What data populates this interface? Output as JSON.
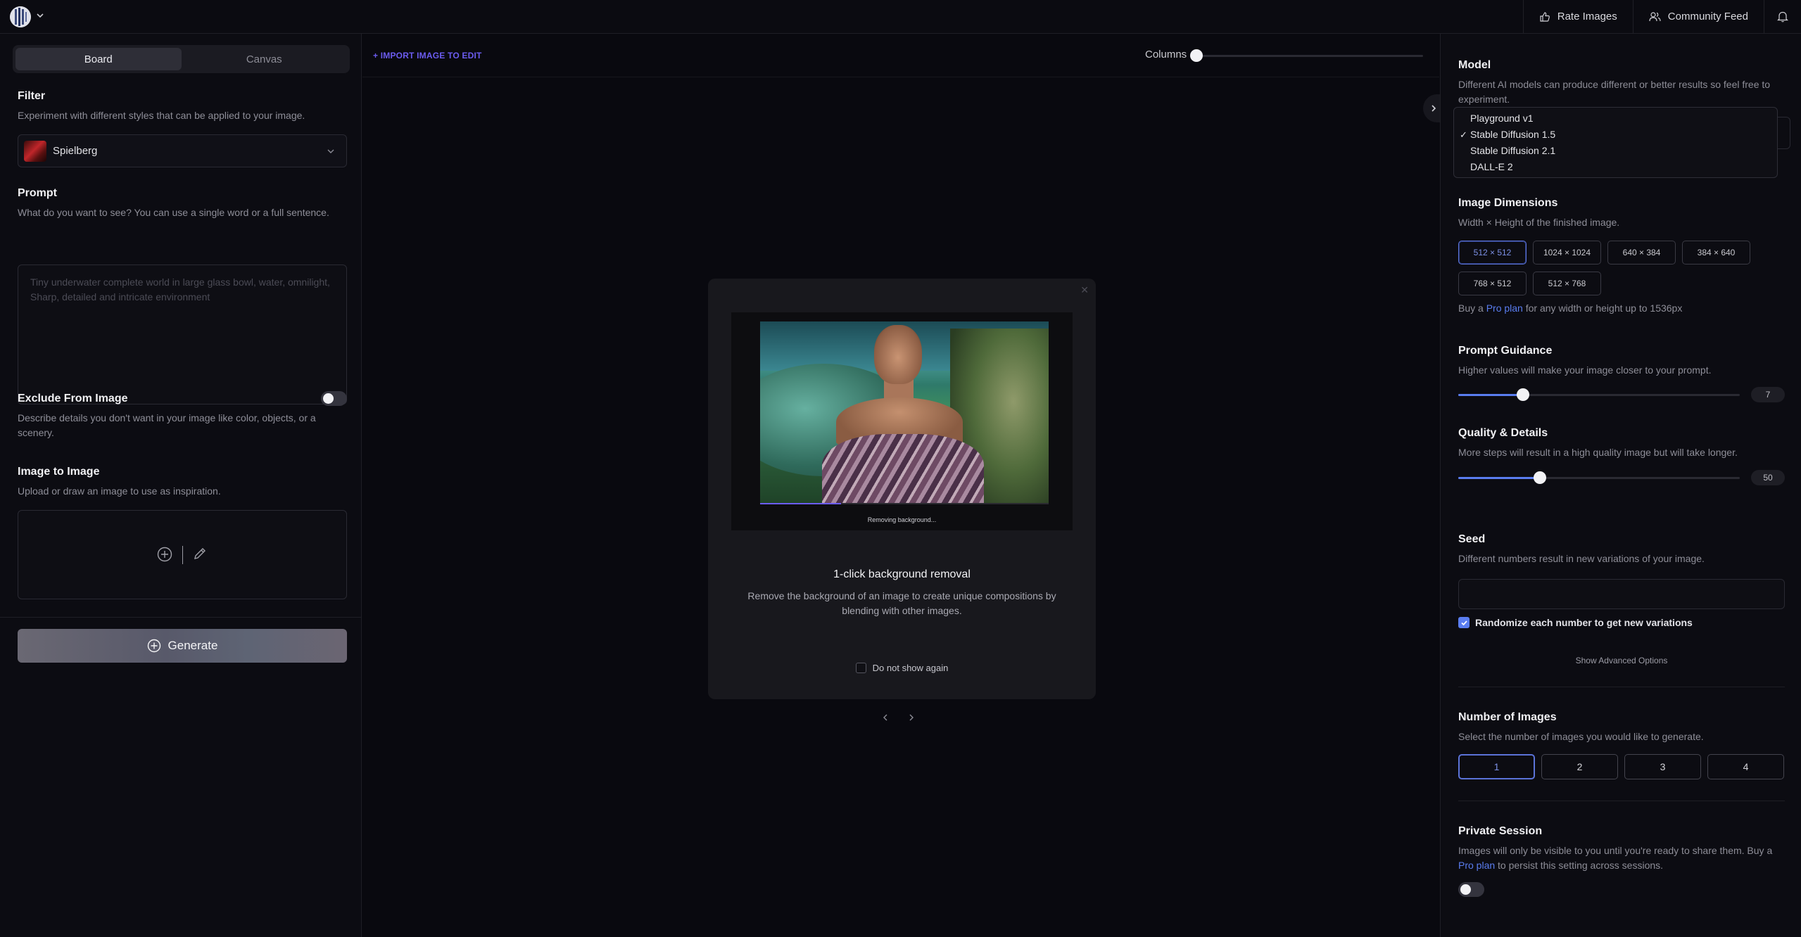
{
  "topbar": {
    "logo_icon": "playground-logo-icon",
    "rate_images": "Rate Images",
    "community_feed": "Community Feed"
  },
  "left": {
    "tabs": [
      {
        "label": "Board",
        "active": true
      },
      {
        "label": "Canvas",
        "active": false
      }
    ],
    "filter": {
      "title": "Filter",
      "description": "Experiment with different styles that can be applied to your image.",
      "selected": "Spielberg"
    },
    "prompt": {
      "title": "Prompt",
      "description": "What do you want to see? You can use a single word or a full sentence.",
      "placeholder": "Tiny underwater complete world in large glass bowl, water, omnilight, Sharp, detailed and intricate environment"
    },
    "exclude": {
      "title": "Exclude From Image",
      "description": "Describe details you don't want in your image like color, objects, or a scenery.",
      "enabled": false
    },
    "img2img": {
      "title": "Image to Image",
      "description": "Upload or draw an image to use as inspiration."
    },
    "generate_label": "Generate"
  },
  "center": {
    "import_label": "+ IMPORT IMAGE TO EDIT",
    "columns_label": "Columns",
    "modal": {
      "status": "Removing background...",
      "progress": 0.28,
      "title": "1-click background removal",
      "description": "Remove the background of an image to create unique compositions by blending with other images.",
      "checkbox_label": "Do not show again",
      "checked": false
    }
  },
  "right": {
    "model": {
      "title": "Model",
      "description": "Different AI models can produce different or better results so feel free to experiment.",
      "options": [
        "Playground v1",
        "Stable Diffusion 1.5",
        "Stable Diffusion 2.1",
        "DALL-E 2"
      ],
      "selected": "Stable Diffusion 1.5"
    },
    "dimensions": {
      "title": "Image Dimensions",
      "description": "Width × Height of the finished image.",
      "options": [
        "512 × 512",
        "1024 × 1024",
        "640 × 384",
        "384 × 640",
        "768 × 512",
        "512 × 768"
      ],
      "selected": "512 × 512",
      "note_prefix": "Buy a ",
      "note_link": "Pro plan",
      "note_suffix": " for any width or height up to 1536px"
    },
    "guidance": {
      "title": "Prompt Guidance",
      "description": "Higher values will make your image closer to your prompt.",
      "value": "7",
      "level": 0.23
    },
    "quality": {
      "title": "Quality & Details",
      "description": "More steps will result in a high quality image but will take longer.",
      "value": "50",
      "level": 0.29
    },
    "seed": {
      "title": "Seed",
      "description": "Different numbers result in new variations of your image.",
      "value": "",
      "randomize_label": "Randomize each number to get new variations",
      "randomize_checked": true
    },
    "advanced_label": "Show Advanced Options",
    "num_images": {
      "title": "Number of Images",
      "description": "Select the number of images you would like to generate.",
      "options": [
        "1",
        "2",
        "3",
        "4"
      ],
      "selected": "1"
    },
    "private": {
      "title": "Private Session",
      "description_prefix": "Images will only be visible to you until you're ready to share them. Buy a ",
      "link": "Pro plan",
      "description_suffix": " to persist this setting across sessions.",
      "enabled": false
    }
  },
  "colors": {
    "accent": "#5a7df0",
    "import_accent": "#6b5cf0",
    "background": "#09090f"
  }
}
